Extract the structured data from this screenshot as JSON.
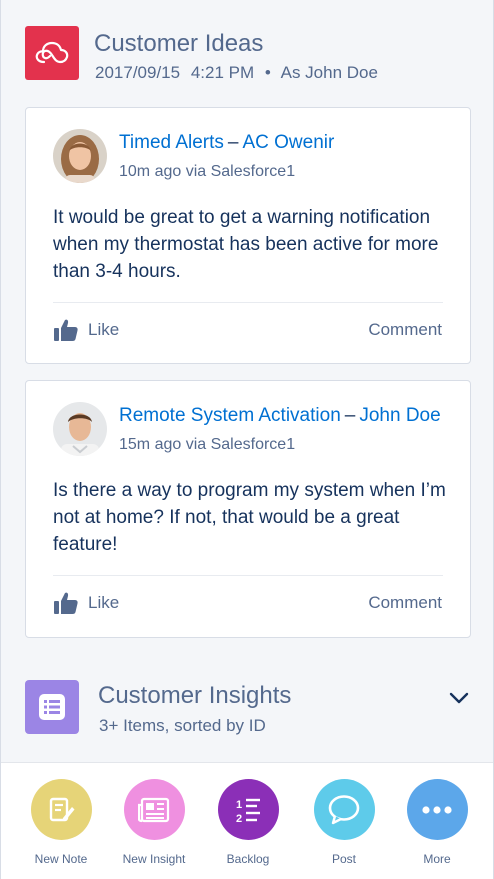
{
  "header": {
    "title": "Customer Ideas",
    "date": "2017/09/15",
    "time": "4:21 PM",
    "separator": "•",
    "as_user": "As John Doe",
    "logo_icon": "cloud-icon",
    "logo_color": "#e3324d"
  },
  "posts": [
    {
      "title": "Timed Alerts",
      "dash": "–",
      "author": "AC Owenir",
      "subtitle": "10m ago via Salesforce1",
      "body": "It would be great to get a warning notification when my thermostat has been active for more than 3-4 hours.",
      "like_label": "Like",
      "comment_label": "Comment"
    },
    {
      "title": "Remote System Activation",
      "dash": "–",
      "author": "John Doe",
      "subtitle": "15m ago via Salesforce1",
      "body": "Is there a way to program my system when I’m not at home? If not, that would be a great feature!",
      "like_label": "Like",
      "comment_label": "Comment"
    }
  ],
  "related": {
    "title": "Customer Insights",
    "subtitle": "3+ Items, sorted by ID",
    "icon": "list-icon",
    "icon_color": "#9b85e5"
  },
  "actions": [
    {
      "label": "New Note",
      "icon": "note-pencil-icon",
      "color": "#e6d478"
    },
    {
      "label": "New Insight",
      "icon": "newspaper-icon",
      "color": "#ef90e0"
    },
    {
      "label": "Backlog",
      "icon": "numbered-list-icon",
      "color": "#8b2fb7"
    },
    {
      "label": "Post",
      "icon": "chat-bubble-icon",
      "color": "#5ecbea"
    },
    {
      "label": "More",
      "icon": "more-dots-icon",
      "color": "#5ca7ea"
    }
  ],
  "colors": {
    "link": "#0070d2",
    "text": "#16325c",
    "muted": "#54698d",
    "background": "#f4f6f9"
  }
}
